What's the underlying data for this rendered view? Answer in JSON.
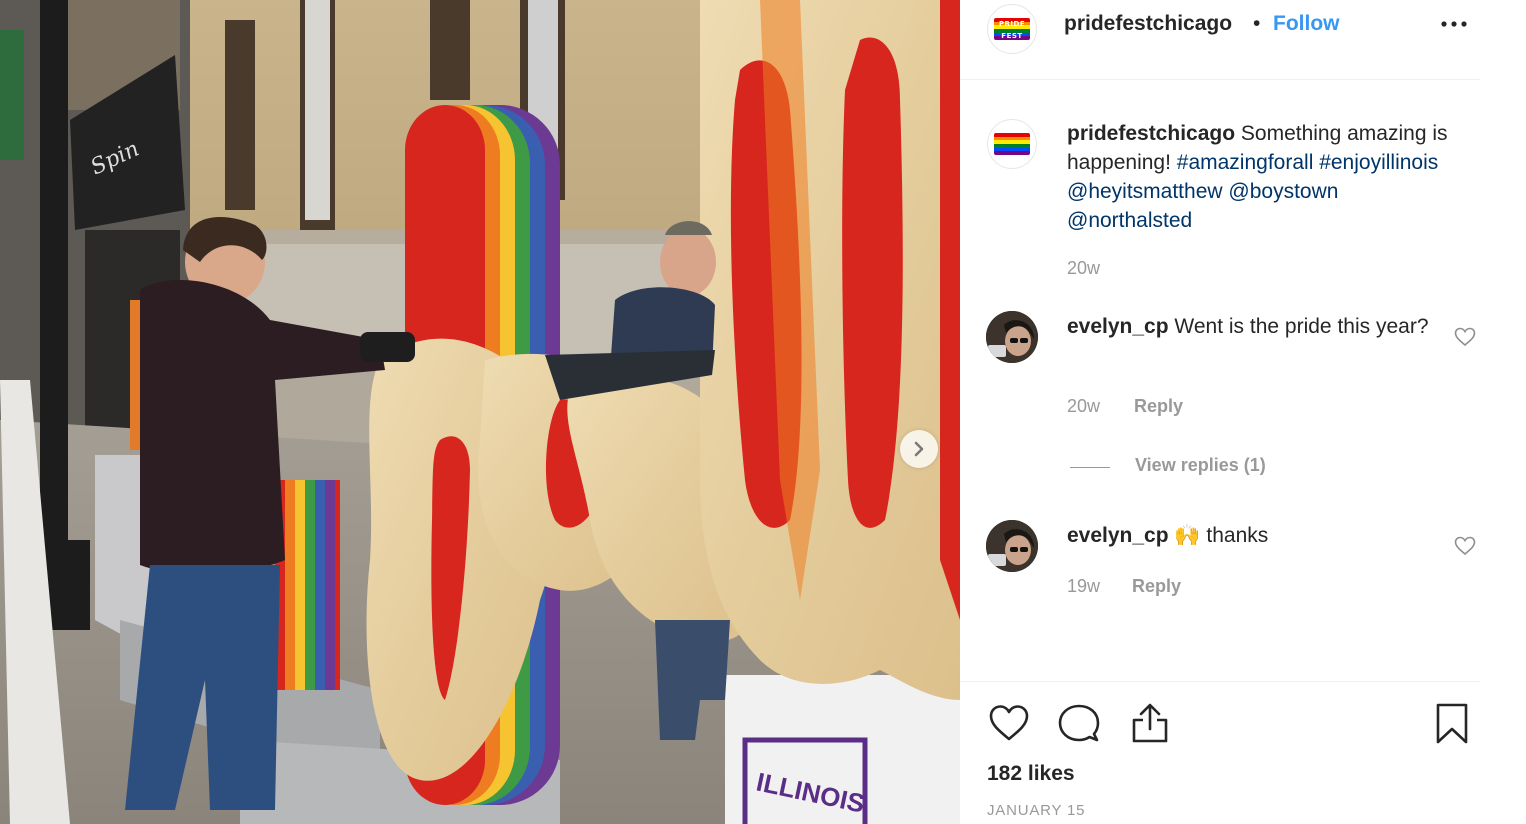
{
  "post": {
    "username": "pridefestchicago",
    "separator": "•",
    "follow_label": "Follow",
    "avatar_text": "PRIDE FEST",
    "flag_colors": [
      "#e40303",
      "#ff8c00",
      "#ffed00",
      "#008026",
      "#004dff",
      "#750787"
    ]
  },
  "caption": {
    "username": "pridefestchicago",
    "text": "Something amazing is happening!",
    "hashtags": [
      "#amazingforall",
      "#enjoyillinois"
    ],
    "mentions": [
      "@heyitsmatthew",
      "@boystown",
      "@northalsted"
    ],
    "age": "20w"
  },
  "comments": [
    {
      "username": "evelyn_cp",
      "text_line1": "Went is the pride this",
      "text_line2": "year?",
      "age": "20w",
      "reply_label": "Reply",
      "view_replies": "View replies (1)"
    },
    {
      "username": "evelyn_cp",
      "emoji": "🙌",
      "text": "thanks",
      "age": "19w",
      "reply_label": "Reply"
    }
  ],
  "stats": {
    "likes": "182 likes",
    "date": "JANUARY 15"
  },
  "photo": {
    "sign_text": "ILLINOIS",
    "rainbow": [
      "#d7261e",
      "#ee7d22",
      "#f6c431",
      "#3f9a45",
      "#3a5fb0",
      "#6d3a93"
    ]
  },
  "icons": {
    "more": "more-options-icon",
    "next": "chevron-right-icon",
    "like": "heart-icon",
    "comment": "comment-icon",
    "share": "share-icon",
    "save": "bookmark-icon"
  }
}
